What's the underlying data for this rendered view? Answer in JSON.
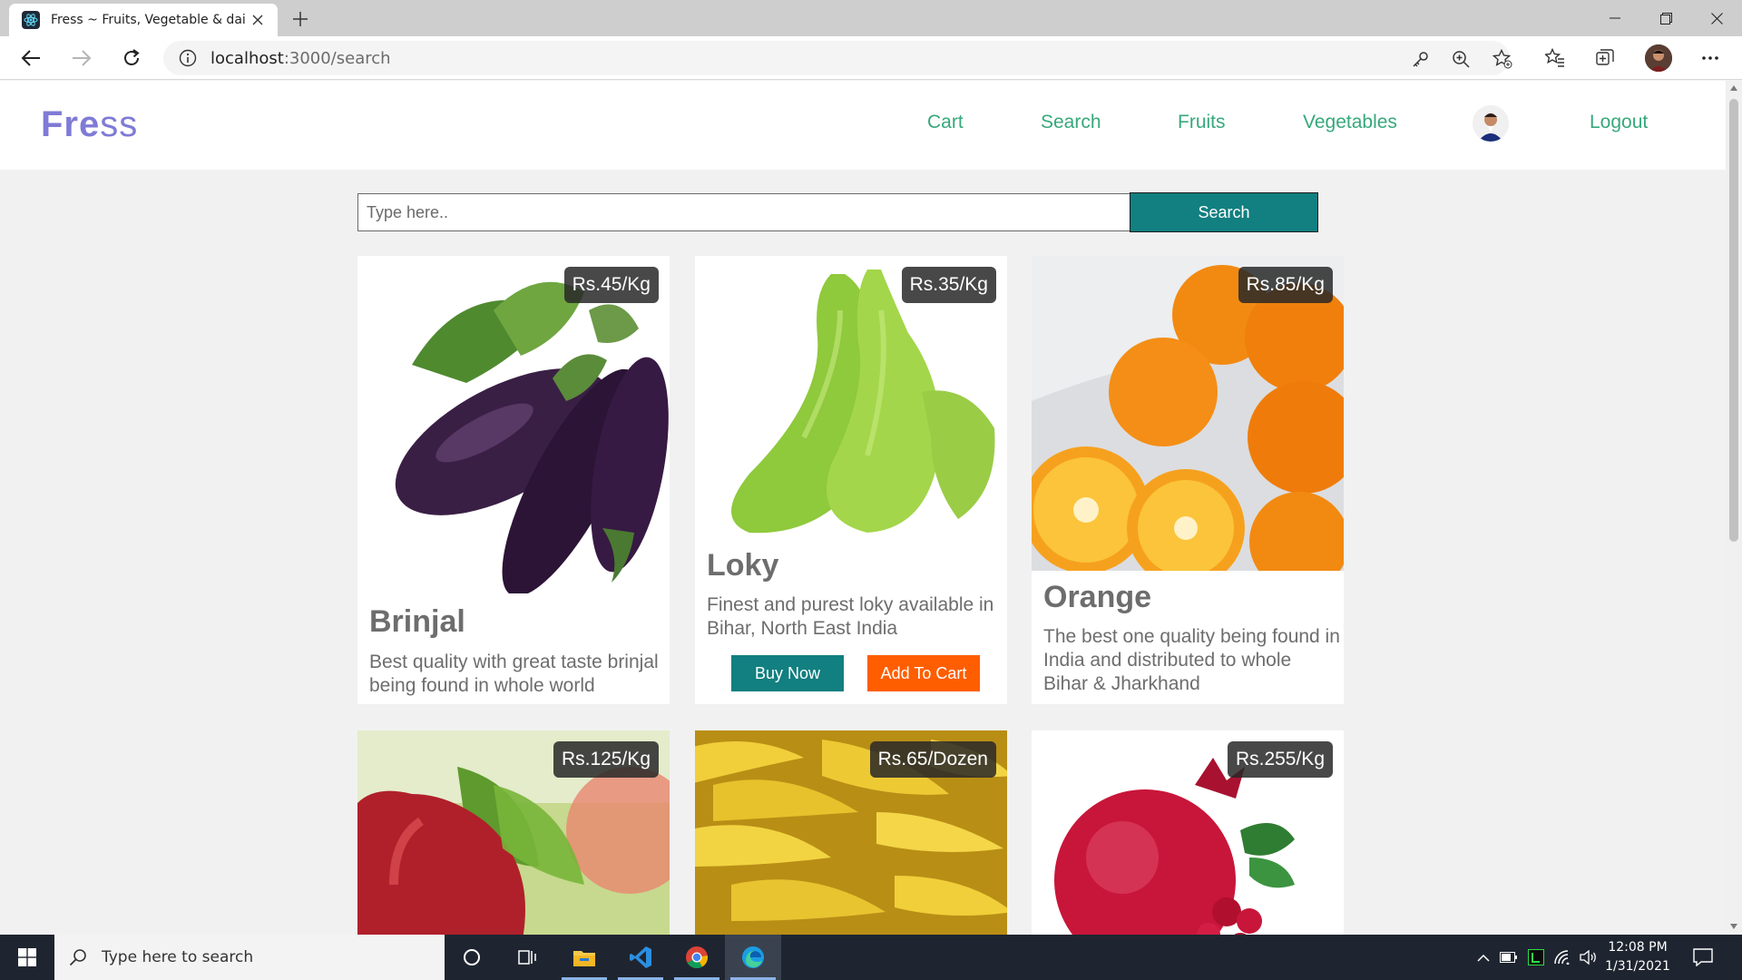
{
  "browser": {
    "tab_title": "Fress ~ Fruits, Vegetable & daily",
    "url_host": "localhost",
    "url_path": ":3000/search"
  },
  "site": {
    "logo_strong": "Fre",
    "logo_light": "ss",
    "nav": {
      "cart": "Cart",
      "search": "Search",
      "fruits": "Fruits",
      "vegetables": "Vegetables",
      "logout": "Logout"
    }
  },
  "search": {
    "placeholder": "Type here..",
    "button_label": "Search"
  },
  "products": [
    {
      "name": "Brinjal",
      "price": "Rs.45/Kg",
      "description": "Best quality with great taste brinjal being found in whole world",
      "image": "brinjal"
    },
    {
      "name": "Loky",
      "price": "Rs.35/Kg",
      "description": "Finest and purest loky available in Bihar, North East India",
      "image": "loky",
      "buy_label": "Buy Now",
      "cart_label": "Add To Cart"
    },
    {
      "name": "Orange",
      "price": "Rs.85/Kg",
      "description": "The best one quality being found in India and distributed to whole Bihar & Jharkhand",
      "image": "orange"
    },
    {
      "price": "Rs.125/Kg",
      "image": "apple"
    },
    {
      "price": "Rs.65/Dozen",
      "image": "banana"
    },
    {
      "price": "Rs.255/Kg",
      "image": "pomegranate"
    }
  ],
  "taskbar": {
    "search_placeholder": "Type here to search",
    "time": "12:08 PM",
    "date": "1/31/2021"
  },
  "colors": {
    "brand": "#7f7bd6",
    "nav_link": "#37a87c",
    "primary_button": "#127f80",
    "cart_button": "#ff5e00"
  }
}
